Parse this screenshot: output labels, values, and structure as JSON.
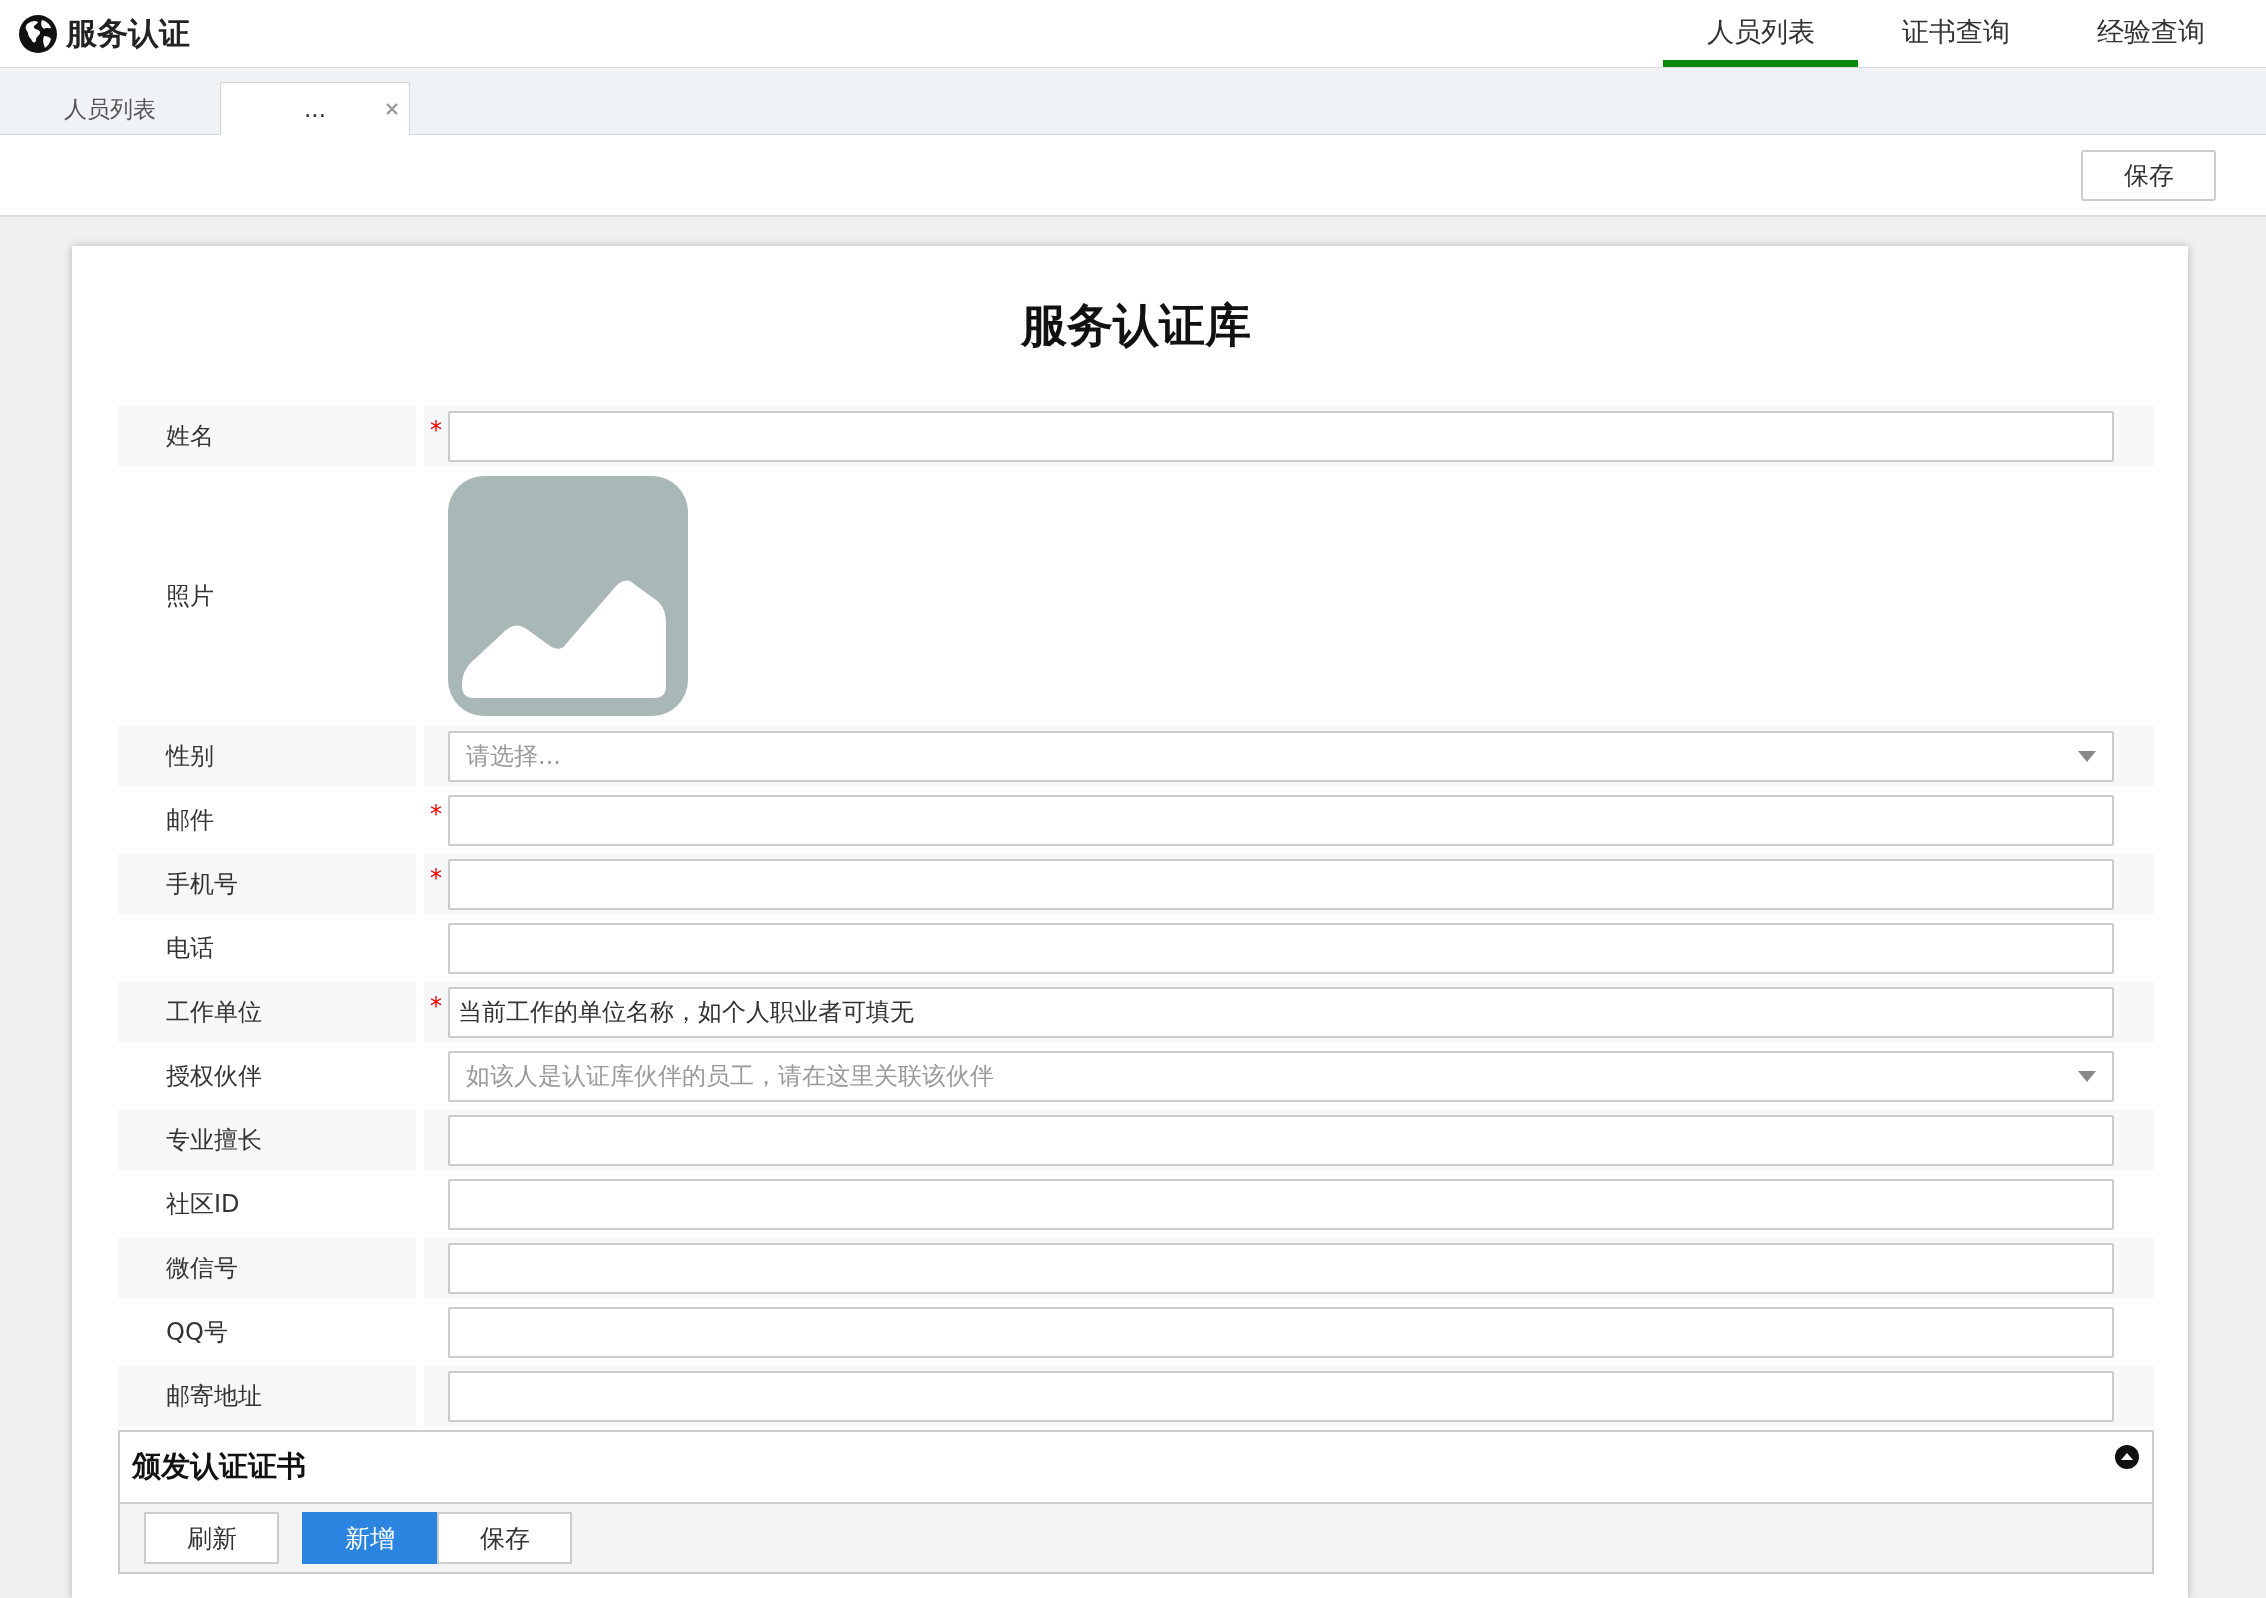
{
  "app": {
    "title": "服务认证"
  },
  "nav": [
    {
      "label": "人员列表",
      "selected": true
    },
    {
      "label": "证书查询",
      "selected": false
    },
    {
      "label": "经验查询",
      "selected": false
    }
  ],
  "tabs": [
    {
      "label": "人员列表",
      "selected": false,
      "closable": false
    },
    {
      "label": "...",
      "selected": true,
      "closable": true
    }
  ],
  "toolbar": {
    "save": "保存"
  },
  "form": {
    "title": "服务认证库",
    "fields": [
      {
        "label": "姓名",
        "kind": "text",
        "required_mark": "*"
      },
      {
        "label": "照片",
        "kind": "photo"
      },
      {
        "label": "性别",
        "kind": "select",
        "placeholder": "请选择..."
      },
      {
        "label": "邮件",
        "kind": "text",
        "required_mark": "*"
      },
      {
        "label": "手机号",
        "kind": "text",
        "required_mark": "*"
      },
      {
        "label": "电话",
        "kind": "text"
      },
      {
        "label": "工作单位",
        "kind": "text",
        "required_mark": "*",
        "value": "当前工作的单位名称，如个人职业者可填无"
      },
      {
        "label": "授权伙伴",
        "kind": "select",
        "placeholder": "如该人是认证库伙伴的员工，请在这里关联该伙伴"
      },
      {
        "label": "专业擅长",
        "kind": "text"
      },
      {
        "label": "社区ID",
        "kind": "text"
      },
      {
        "label": "微信号",
        "kind": "text"
      },
      {
        "label": "QQ号",
        "kind": "text"
      },
      {
        "label": "邮寄地址",
        "kind": "text"
      }
    ]
  },
  "panel": {
    "title": "颁发认证证书",
    "buttons": [
      {
        "label": "刷新",
        "selected": false
      },
      {
        "label": "新增",
        "selected": true
      },
      {
        "label": "保存",
        "selected": false
      }
    ]
  }
}
